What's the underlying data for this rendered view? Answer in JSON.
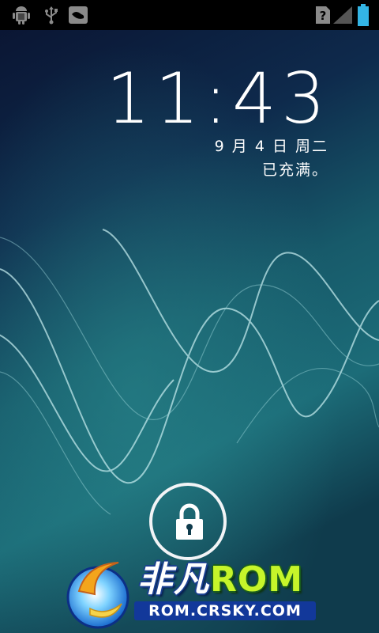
{
  "status_bar": {
    "left_icons": [
      "android-debug-icon",
      "usb-icon",
      "cloud-icon"
    ],
    "right_icons": [
      "no-sim-icon",
      "signal-strength-icon",
      "battery-full-icon"
    ],
    "sim_symbol": "?"
  },
  "lockscreen": {
    "time": "11:43",
    "date": "9 月 4 日 周二",
    "charging_status": "已充满。",
    "unlock_icon": "lock-icon"
  },
  "watermark": {
    "brand_cn": "非凡",
    "brand_en": "ROM",
    "url": "ROM.CRSKY.COM",
    "logo_icon": "crsky-swirl-logo"
  },
  "colors": {
    "statusbar_bg": "#000000",
    "wallpaper_dark": "#0a1330",
    "wallpaper_teal": "#1c6c78",
    "battery": "#33b5e5",
    "brand_green": "#c6f52a",
    "url_bar": "#12389a"
  }
}
